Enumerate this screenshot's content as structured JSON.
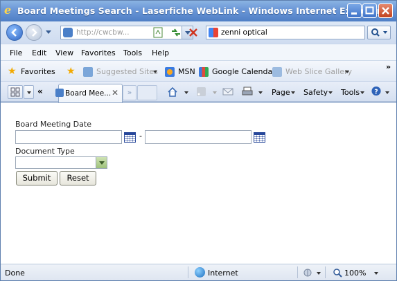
{
  "window": {
    "title": "Board Meetings Search - Laserfiche WebLink - Windows Internet Explorer"
  },
  "address_bar": {
    "url": "http://cwcbw...",
    "search_text": "zenni optical"
  },
  "menu": {
    "items": [
      "File",
      "Edit",
      "View",
      "Favorites",
      "Tools",
      "Help"
    ]
  },
  "favorites_bar": {
    "favorites_label": "Favorites",
    "items": [
      {
        "label": "Suggested Sites",
        "enabled": false
      },
      {
        "label": "MSN",
        "enabled": true
      },
      {
        "label": "Google Calendar",
        "enabled": true
      },
      {
        "label": "Web Slice Gallery",
        "enabled": false
      }
    ]
  },
  "tabs": {
    "active_label": "Board Mee...",
    "command_items": [
      "Page",
      "Safety",
      "Tools"
    ]
  },
  "form": {
    "date_label": "Board Meeting Date",
    "date_separator": "-",
    "start_date_value": "",
    "end_date_value": "",
    "doc_type_label": "Document Type",
    "doc_type_value": "",
    "submit_label": "Submit",
    "reset_label": "Reset"
  },
  "status_bar": {
    "status": "Done",
    "zone": "Internet",
    "zoom": "100%"
  },
  "colors": {
    "titlebar": "#4f7fc6",
    "calendar_icon": "#27479a",
    "content_bg": "#ffffff"
  },
  "icons": [
    "ie-logo-icon",
    "back-icon",
    "forward-icon",
    "refresh-icon",
    "stop-icon",
    "search-icon",
    "favorites-star-icon",
    "home-icon",
    "feeds-icon",
    "mail-icon",
    "print-icon",
    "help-icon",
    "calendar-icon",
    "globe-icon",
    "zoom-icon"
  ]
}
